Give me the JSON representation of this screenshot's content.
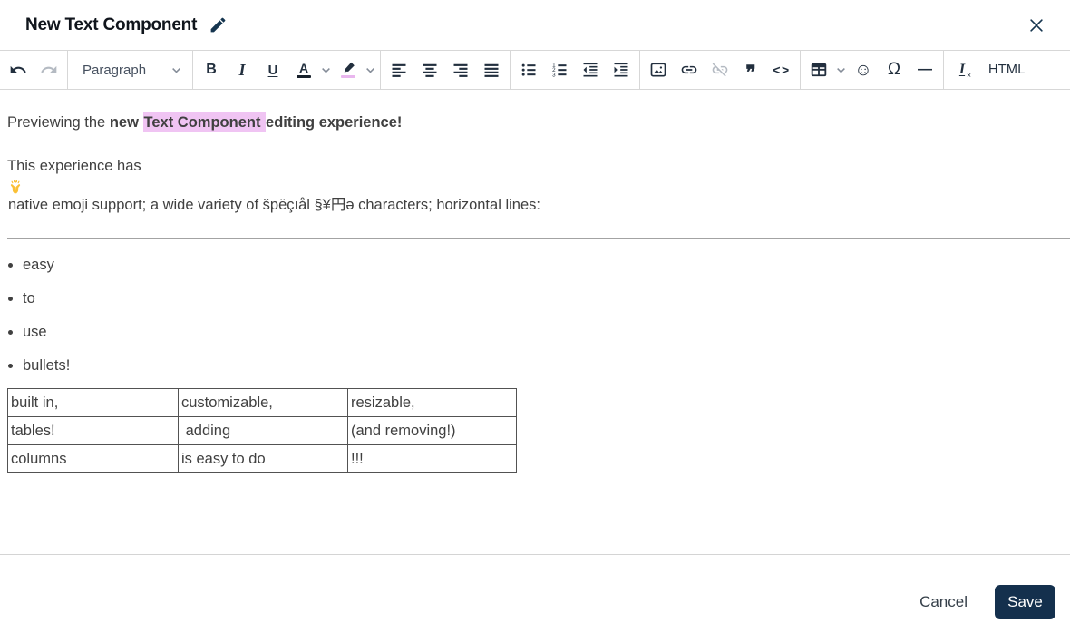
{
  "colors": {
    "accent_navy": "#14304d",
    "highlight_pink": "#f0c4f3",
    "toolbar_icon": "#222f3e",
    "disabled_icon": "#b4bac2",
    "border_gray": "#d7d7d7",
    "content_text": "#404040"
  },
  "header": {
    "title": "New Text Component"
  },
  "toolbar": {
    "paragraph_dropdown_value": "Paragraph",
    "bold": "B",
    "italic": "I",
    "underline": "U",
    "font_color_letter": "A",
    "blockquote_glyph": "❞",
    "code_glyph": "<>",
    "smiley_glyph": "☺",
    "special_char_glyph": "Ω",
    "horizontal_line_glyph": "—",
    "clear_format_letter": "I",
    "clear_format_x": "×",
    "html_label": "HTML"
  },
  "editor": {
    "paragraph1": {
      "normal": "Previewing the ",
      "bold": "new ",
      "highlighted": "Text Component ",
      "bold_end": "editing experience!"
    },
    "paragraph2": {
      "before_emoji": "This experience has ",
      "emoji": "🙌",
      "after_emoji": " native emoji support; a wide variety of špëçīål §¥円ǝ characters; horizontal lines:"
    },
    "bullets": [
      "easy",
      "to",
      "use",
      "bullets!"
    ],
    "table_rows": [
      [
        "built in,",
        "customizable,",
        "resizable,"
      ],
      [
        "tables!",
        " adding",
        "(and removing!)"
      ],
      [
        "columns",
        "is easy to do",
        "!!!"
      ]
    ]
  },
  "footer": {
    "cancel_label": "Cancel",
    "save_label": "Save"
  }
}
